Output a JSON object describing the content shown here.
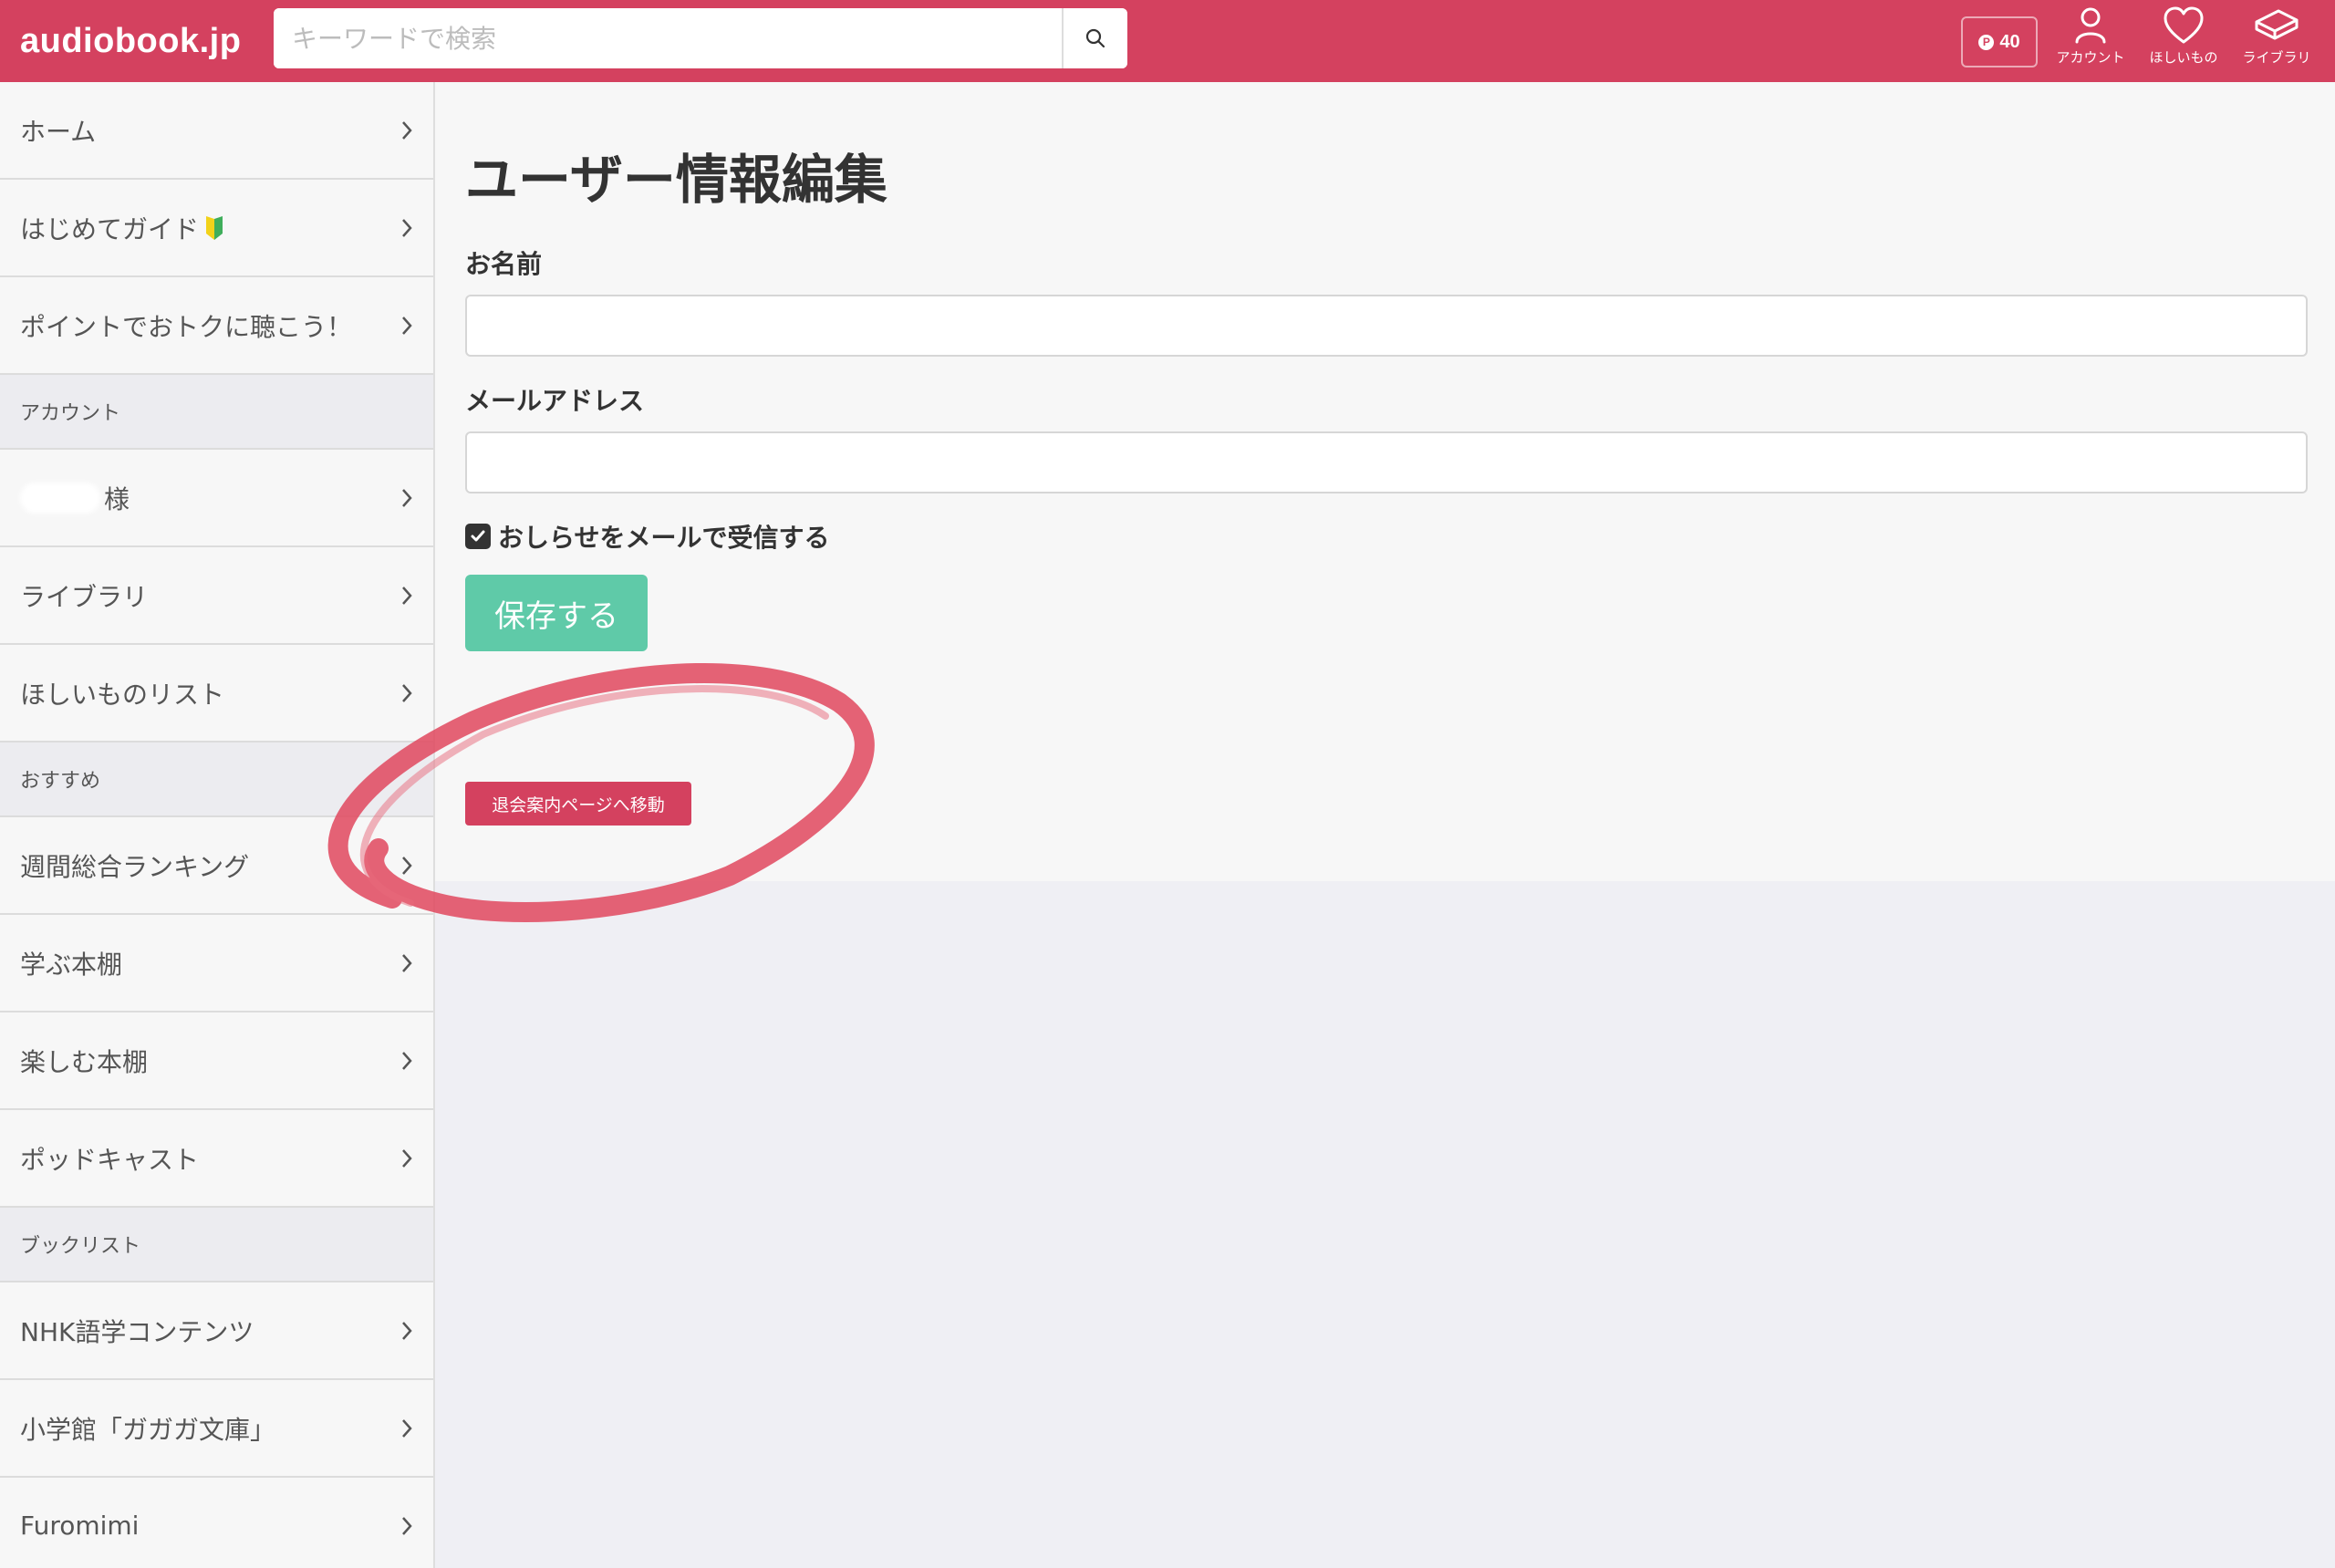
{
  "header": {
    "logo": "audiobook.jp",
    "search_placeholder": "キーワードで検索",
    "points": "40",
    "points_icon": "P",
    "nav": [
      {
        "label": "アカウント",
        "icon": "person-icon"
      },
      {
        "label": "ほしいもの",
        "icon": "heart-icon"
      },
      {
        "label": "ライブラリ",
        "icon": "book-icon"
      }
    ],
    "colors": {
      "brand": "#d4415f",
      "save": "#5fcaa8"
    }
  },
  "sidebar": {
    "home": "ホーム",
    "guide": "はじめてガイド",
    "points_promo": "ポイントでおトクに聴こう！",
    "account_header": "アカウント",
    "user_suffix": "様",
    "library": "ライブラリ",
    "wishlist": "ほしいものリスト",
    "recommend_header": "おすすめ",
    "weekly_ranking": "週間総合ランキング",
    "learn_shelf": "学ぶ本棚",
    "enjoy_shelf": "楽しむ本棚",
    "podcast": "ポッドキャスト",
    "booklist_header": "ブックリスト",
    "nhk": "NHK語学コンテンツ",
    "gagaga": "小学館「ガガガ文庫」",
    "furomimi": "Furomimi"
  },
  "main": {
    "title": "ユーザー情報編集",
    "name_label": "お名前",
    "name_value": "",
    "email_label": "メールアドレス",
    "email_value": "",
    "newsletter_label": "おしらせをメールで受信する",
    "newsletter_checked": true,
    "save_button": "保存する",
    "withdraw_button": "退会案内ページへ移動"
  }
}
